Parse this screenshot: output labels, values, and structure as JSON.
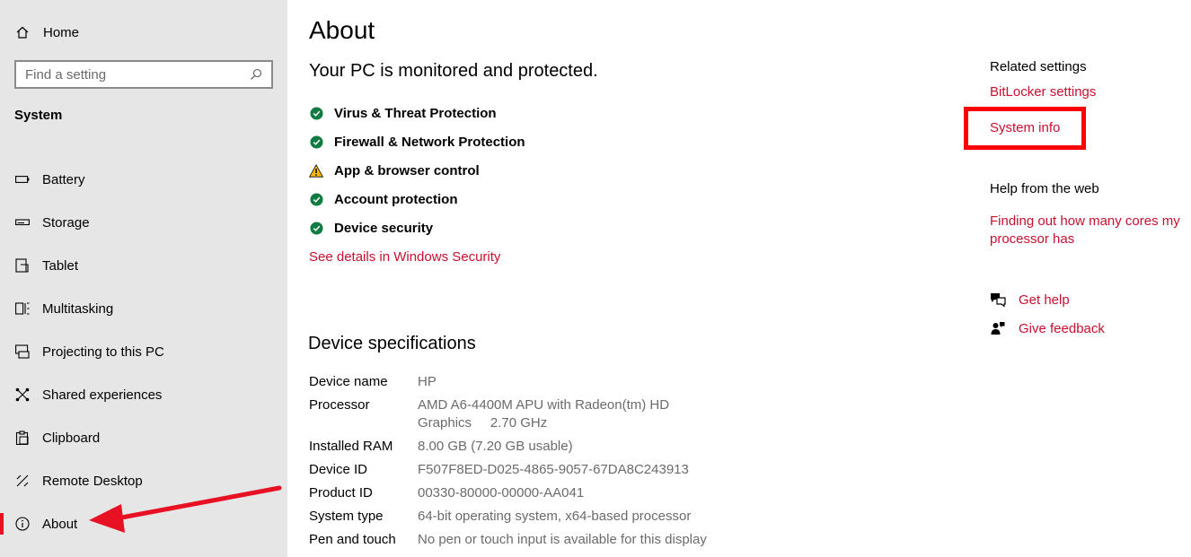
{
  "sidebar": {
    "home_label": "Home",
    "search_placeholder": "Find a setting",
    "section_title": "System",
    "items": [
      {
        "label": "Battery",
        "icon": "battery-icon"
      },
      {
        "label": "Storage",
        "icon": "storage-icon"
      },
      {
        "label": "Tablet",
        "icon": "tablet-icon"
      },
      {
        "label": "Multitasking",
        "icon": "multitasking-icon"
      },
      {
        "label": "Projecting to this PC",
        "icon": "projecting-icon"
      },
      {
        "label": "Shared experiences",
        "icon": "shared-experiences-icon"
      },
      {
        "label": "Clipboard",
        "icon": "clipboard-icon"
      },
      {
        "label": "Remote Desktop",
        "icon": "remote-desktop-icon"
      },
      {
        "label": "About",
        "icon": "info-icon",
        "active": true
      }
    ]
  },
  "main": {
    "title": "About",
    "protection_heading": "Your PC is monitored and protected.",
    "protection_items": [
      {
        "label": "Virus & Threat Protection",
        "status": "ok"
      },
      {
        "label": "Firewall & Network Protection",
        "status": "ok"
      },
      {
        "label": "App & browser control",
        "status": "warning"
      },
      {
        "label": "Account protection",
        "status": "ok"
      },
      {
        "label": "Device security",
        "status": "ok"
      }
    ],
    "security_link": "See details in Windows Security",
    "specs_heading": "Device specifications",
    "specs": [
      {
        "key": "Device name",
        "value": "HP"
      },
      {
        "key": "Processor",
        "value": "AMD A6-4400M APU with Radeon(tm) HD Graphics     2.70 GHz"
      },
      {
        "key": "Installed RAM",
        "value": "8.00 GB (7.20 GB usable)"
      },
      {
        "key": "Device ID",
        "value": "F507F8ED-D025-4865-9057-67DA8C243913"
      },
      {
        "key": "Product ID",
        "value": "00330-80000-00000-AA041"
      },
      {
        "key": "System type",
        "value": "64-bit operating system, x64-based processor"
      },
      {
        "key": "Pen and touch",
        "value": "No pen or touch input is available for this display"
      }
    ]
  },
  "right": {
    "related_heading": "Related settings",
    "bitlocker_link": "BitLocker settings",
    "system_info_link": "System info",
    "help_heading": "Help from the web",
    "cores_link": "Finding out how many cores my processor has",
    "get_help": "Get help",
    "give_feedback": "Give feedback"
  },
  "colors": {
    "accent": "#c8102e",
    "ok": "#107c41",
    "warning": "#ffb900",
    "annotation": "#ff0000"
  }
}
